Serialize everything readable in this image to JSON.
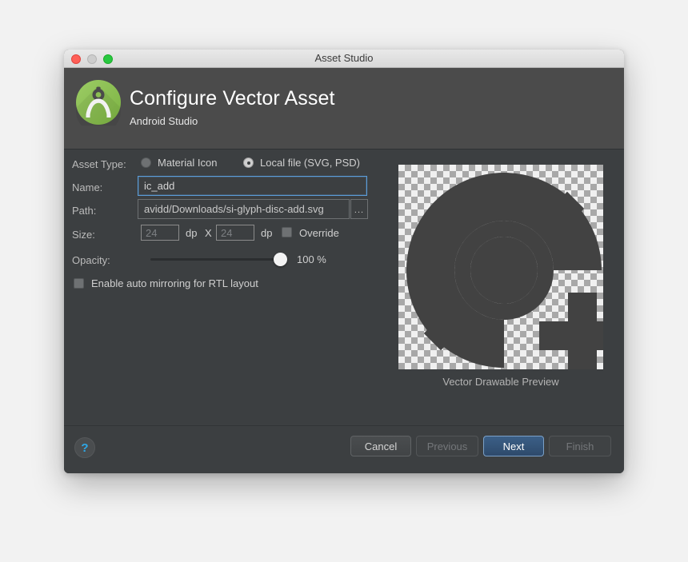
{
  "window": {
    "title": "Asset Studio",
    "traffic_lights": [
      "close-button",
      "minimize-button",
      "maximize-button"
    ]
  },
  "header": {
    "title": "Configure Vector Asset",
    "subtitle": "Android Studio",
    "logo_icon": "android-studio-logo"
  },
  "form": {
    "asset_type": {
      "label": "Asset Type:",
      "options": [
        {
          "label": "Material Icon",
          "selected": false
        },
        {
          "label": "Local file (SVG, PSD)",
          "selected": true
        }
      ]
    },
    "name": {
      "label": "Name:",
      "value": "ic_add",
      "placeholder": "ic_add"
    },
    "path": {
      "label": "Path:",
      "value": "avidd/Downloads/si-glyph-disc-add.svg",
      "placeholder": "Select a file",
      "browse_label": "..."
    },
    "size": {
      "label": "Size:",
      "width_value": "24",
      "height_value": "24",
      "unit": "dp",
      "separator": "X",
      "override_label": "Override",
      "override_checked": false
    },
    "opacity": {
      "label": "Opacity:",
      "value": "100 %",
      "percent": 100
    },
    "rtl": {
      "label": "Enable auto mirroring for RTL layout",
      "checked": false
    }
  },
  "preview": {
    "caption": "Vector Drawable Preview",
    "glyph_icon": "disc-add-glyph",
    "glyph_color": "#424242",
    "checker_light": "#f0f0f0",
    "checker_dark": "#a8a8a8"
  },
  "footer": {
    "help_label": "?",
    "help_icon": "question-mark-icon",
    "buttons": [
      {
        "label": "Cancel",
        "state": "enabled"
      },
      {
        "label": "Previous",
        "state": "disabled"
      },
      {
        "label": "Next",
        "state": "primary"
      },
      {
        "label": "Finish",
        "state": "disabled"
      }
    ]
  },
  "colors": {
    "window_bg": "#3c3f41",
    "header_bg": "#4b4b4b",
    "accent_blue": "#5b9dd9",
    "primary_button": "#2e4a6b",
    "help_blue": "#2da8e8",
    "logo_green": "#8bc34a"
  }
}
